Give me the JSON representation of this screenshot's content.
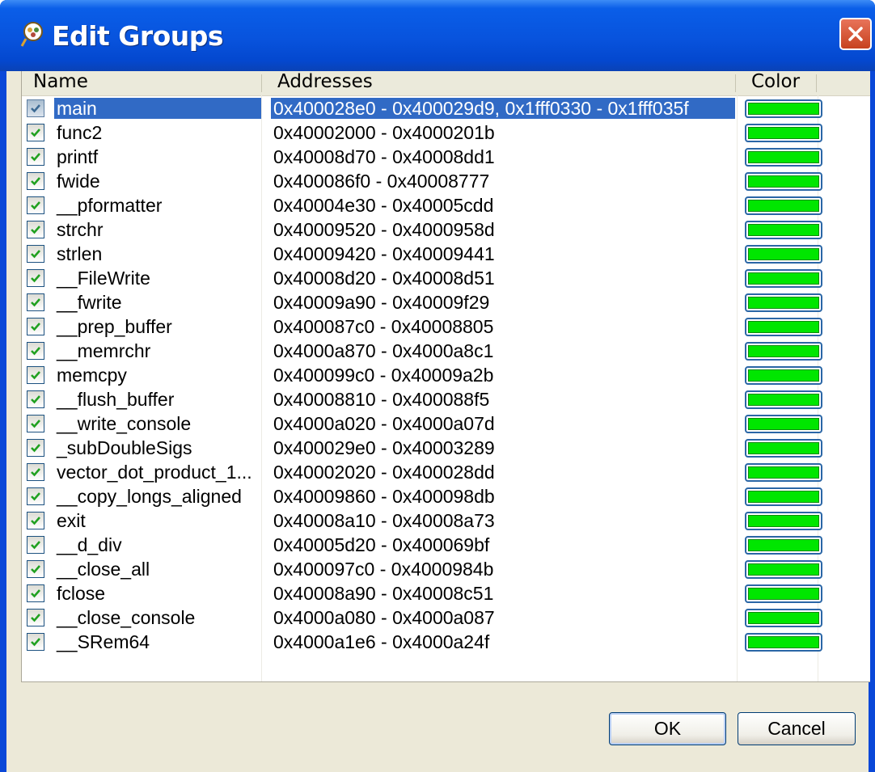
{
  "window": {
    "title": "Edit Groups"
  },
  "table": {
    "columns": [
      "Name",
      "Addresses",
      "Color"
    ],
    "swatch_color": "#00e600",
    "rows": [
      {
        "name": "main",
        "addresses": "0x400028e0 - 0x400029d9, 0x1fff0330 - 0x1fff035f",
        "checked": true,
        "selected": true
      },
      {
        "name": "func2",
        "addresses": "0x40002000 - 0x4000201b",
        "checked": true
      },
      {
        "name": "printf",
        "addresses": "0x40008d70 - 0x40008dd1",
        "checked": true
      },
      {
        "name": "fwide",
        "addresses": "0x400086f0 - 0x40008777",
        "checked": true
      },
      {
        "name": "__pformatter",
        "addresses": "0x40004e30 - 0x40005cdd",
        "checked": true
      },
      {
        "name": "strchr",
        "addresses": "0x40009520 - 0x4000958d",
        "checked": true
      },
      {
        "name": "strlen",
        "addresses": "0x40009420 - 0x40009441",
        "checked": true
      },
      {
        "name": "__FileWrite",
        "addresses": "0x40008d20 - 0x40008d51",
        "checked": true
      },
      {
        "name": "__fwrite",
        "addresses": "0x40009a90 - 0x40009f29",
        "checked": true
      },
      {
        "name": "__prep_buffer",
        "addresses": "0x400087c0 - 0x40008805",
        "checked": true
      },
      {
        "name": "__memrchr",
        "addresses": "0x4000a870 - 0x4000a8c1",
        "checked": true
      },
      {
        "name": "memcpy",
        "addresses": "0x400099c0 - 0x40009a2b",
        "checked": true
      },
      {
        "name": "__flush_buffer",
        "addresses": "0x40008810 - 0x400088f5",
        "checked": true
      },
      {
        "name": "__write_console",
        "addresses": "0x4000a020 - 0x4000a07d",
        "checked": true
      },
      {
        "name": "_subDoubleSigs",
        "addresses": "0x400029e0 - 0x40003289",
        "checked": true
      },
      {
        "name": "vector_dot_product_1...",
        "addresses": "0x40002020 - 0x400028dd",
        "checked": true
      },
      {
        "name": "__copy_longs_aligned",
        "addresses": "0x40009860 - 0x400098db",
        "checked": true
      },
      {
        "name": "exit",
        "addresses": "0x40008a10 - 0x40008a73",
        "checked": true
      },
      {
        "name": "__d_div",
        "addresses": "0x40005d20 - 0x400069bf",
        "checked": true
      },
      {
        "name": "__close_all",
        "addresses": "0x400097c0 - 0x4000984b",
        "checked": true
      },
      {
        "name": "fclose",
        "addresses": "0x40008a90 - 0x40008c51",
        "checked": true
      },
      {
        "name": "__close_console",
        "addresses": "0x4000a080 - 0x4000a087",
        "checked": true
      },
      {
        "name": "__SRem64",
        "addresses": "0x4000a1e6 - 0x4000a24f",
        "checked": true
      }
    ]
  },
  "buttons": {
    "ok": "OK",
    "cancel": "Cancel"
  },
  "icons": {
    "app": "groups-icon",
    "close": "close-icon",
    "check": "check-icon"
  }
}
